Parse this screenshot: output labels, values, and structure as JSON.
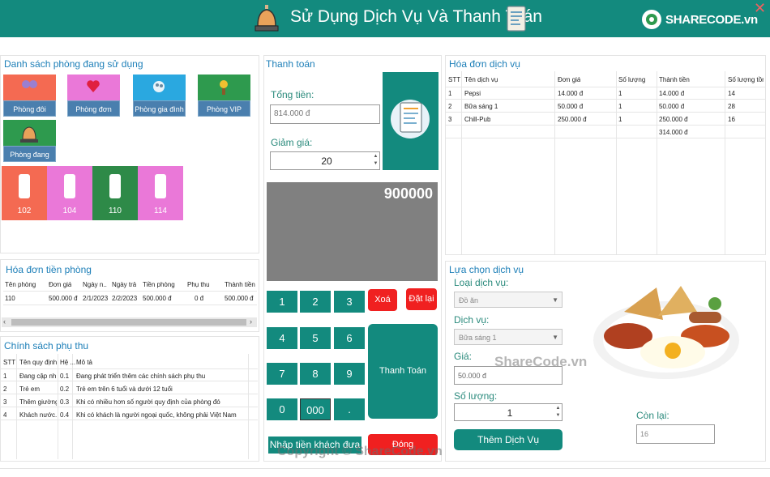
{
  "window": {
    "title": "Sử Dụng Dịch Vụ Và Thanh Toán",
    "logo_text": "SHARECODE.vn",
    "close_glyph": "✕"
  },
  "rooms_section": {
    "title": "Danh sách phòng đang sử dụng",
    "room_types": [
      {
        "label": "Phòng đôi",
        "color": "#f46a52"
      },
      {
        "label": "Phòng đơn",
        "color": "#ea78d8"
      },
      {
        "label": "Phòng gia đình",
        "color": "#2aa8e0"
      },
      {
        "label": "Phòng VIP",
        "color": "#2e9a4e"
      },
      {
        "label": "Phòng đang chọn",
        "color": "#2e9a4e"
      }
    ],
    "rooms": [
      {
        "number": "102",
        "color": "#f46a52"
      },
      {
        "number": "104",
        "color": "#ea78d8"
      },
      {
        "number": "110",
        "color": "#2e8a48"
      },
      {
        "number": "114",
        "color": "#ea78d8"
      }
    ]
  },
  "payment": {
    "title": "Thanh toán",
    "total_label": "Tổng tiền:",
    "total_value": "814.000 đ",
    "discount_label": "Giảm giá:",
    "discount_value": "20",
    "display": "900000",
    "keys": [
      "1",
      "2",
      "3",
      "4",
      "5",
      "6",
      "7",
      "8",
      "9",
      "0",
      "000",
      "."
    ],
    "clear_label": "Xoá",
    "reset_label": "Đặt lại",
    "pay_label": "Thanh Toán",
    "enter_cash_label": "Nhập tiền khách đưa",
    "close_label": "Đóng"
  },
  "service_invoice": {
    "title": "Hóa đơn dịch vụ",
    "headers": [
      "STT",
      "Tên dịch vụ",
      "Đơn giá",
      "Số lượng",
      "Thành tiền",
      "Số lượng tồn"
    ],
    "rows": [
      [
        "1",
        "Pepsi",
        "14.000 đ",
        "1",
        "14.000 đ",
        "14"
      ],
      [
        "2",
        "Bữa sáng 1",
        "50.000 đ",
        "1",
        "50.000 đ",
        "28"
      ],
      [
        "3",
        "Chill-Pub",
        "250.000 đ",
        "1",
        "250.000 đ",
        "16"
      ]
    ],
    "total": "314.000 đ"
  },
  "room_invoice": {
    "title": "Hóa đơn tiền phòng",
    "headers": [
      "Tên phòng",
      "Đơn giá",
      "Ngày n...",
      "Ngày trả",
      "Tiền phòng",
      "Phụ thu",
      "Thành tiền"
    ],
    "rows": [
      [
        "110",
        "500.000 đ",
        "2/1/2023",
        "2/2/2023",
        "500.000 đ",
        "0 đ",
        "500.000 đ"
      ]
    ]
  },
  "surcharge": {
    "title": "Chính sách phụ thu",
    "headers": [
      "STT",
      "Tên quy định",
      "Hệ ...",
      "Mô tả"
    ],
    "rows": [
      [
        "1",
        "Đang cập nh...",
        "0.1",
        "Đang phát triển thêm các chính sách phụ thu"
      ],
      [
        "2",
        "Trẻ em",
        "0.2",
        "Trẻ em trên 6 tuổi và dưới 12 tuổi"
      ],
      [
        "3",
        "Thêm giường",
        "0.3",
        "Khi có nhiều hơn số người quy định của phòng đó"
      ],
      [
        "4",
        "Khách nước...",
        "0.4",
        "Khi có khách là người ngoại quốc, không phải Việt Nam"
      ]
    ]
  },
  "service_select": {
    "title": "Lựa chọn dịch vụ",
    "type_label": "Loại dịch vụ:",
    "type_value": "Đồ ăn",
    "service_label": "Dịch vụ:",
    "service_value": "Bữa sáng 1",
    "price_label": "Giá:",
    "price_value": "50.000 đ",
    "qty_label": "Số lượng:",
    "qty_value": "1",
    "remain_label": "Còn lại:",
    "remain_value": "16",
    "add_label": "Thêm Dịch Vụ"
  },
  "watermark": {
    "site": "ShareCode.vn",
    "copyright": "Copyright © ShareCode.vn"
  },
  "colors": {
    "teal": "#138a7e",
    "red": "#f02020",
    "blue_label": "#1d7fb8"
  }
}
